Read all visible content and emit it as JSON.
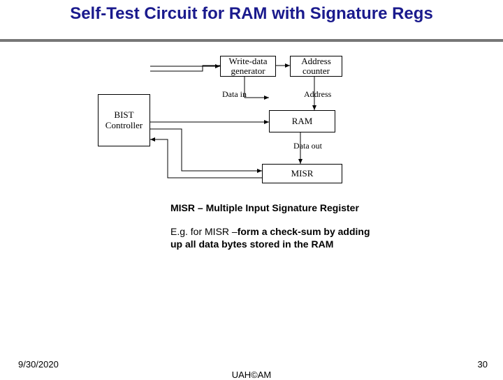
{
  "title": "Self-Test Circuit for RAM with Signature Regs",
  "diagram": {
    "blocks": {
      "bist": "BIST\nController",
      "wdg": "Write-data\ngenerator",
      "addr_ctr": "Address\ncounter",
      "ram": "RAM",
      "misr": "MISR"
    },
    "labels": {
      "data_in": "Data in",
      "address": "Address",
      "data_out": "Data out"
    }
  },
  "notes": {
    "misr_def": "MISR – Multiple Input Signature Register",
    "example_lead": "E.g. for MISR –",
    "example_rest": "form a check-sum by adding up all data bytes stored in the RAM"
  },
  "footer": {
    "date": "9/30/2020",
    "center": "UAH©AM",
    "page": "30"
  }
}
